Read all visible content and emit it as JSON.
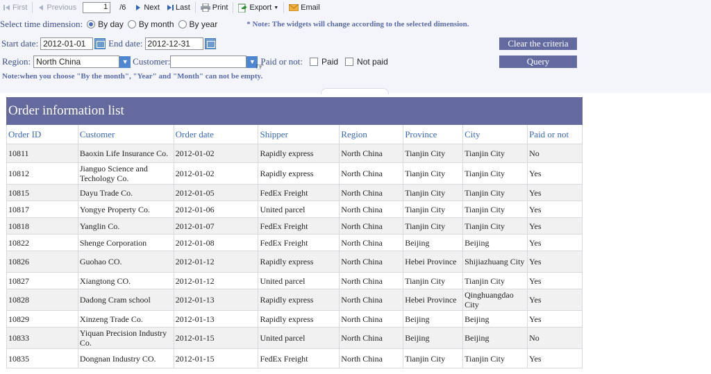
{
  "toolbar": {
    "first": "First",
    "previous": "Previous",
    "page": "1",
    "total": "/6",
    "next": "Next",
    "last": "Last",
    "print": "Print",
    "export": "Export",
    "email": "Email"
  },
  "time": {
    "label": "Select time dimension:",
    "options": [
      "By day",
      "By month",
      "By year"
    ],
    "selected": "By day",
    "note": "* Note: The widgets will change according to the selected dimension."
  },
  "dates": {
    "start_label": "Start date:",
    "start": "2012-01-01",
    "end_label": "End date:",
    "end": "2012-12-31"
  },
  "filters": {
    "region_label": "Region:",
    "region": "North China",
    "customer_label": "Customer:",
    "customer": "",
    "paid_label": "Paid or not:",
    "paid": "Paid",
    "not_paid": "Not paid"
  },
  "buttons": {
    "clear": "Clear the criteria",
    "query": "Query"
  },
  "note2": "Note:when you choose \"By the month\", \"Year\" and \"Month\" can not be empty.",
  "table": {
    "title": "Order information list",
    "columns": [
      "Order ID",
      "Customer",
      "Order date",
      "Shipper",
      "Region",
      "Province",
      "City",
      "Paid or not"
    ],
    "rows": [
      [
        "10811",
        "Baoxin Life Insurance Co.",
        "2012-01-02",
        "Rapidly express",
        "North China",
        "Tianjin City",
        "Tianjin City",
        "No"
      ],
      [
        "10812",
        "Jianguo Science and Techology Co.",
        "2012-01-02",
        "Rapidly express",
        "North China",
        "Tianjin City",
        "Tianjin City",
        "Yes"
      ],
      [
        "10815",
        "Dayu Trade Co.",
        "2012-01-05",
        "FedEx Freight",
        "North China",
        "Tianjin City",
        "Tianjin City",
        "Yes"
      ],
      [
        "10817",
        "Yongye Property Co.",
        "2012-01-06",
        "United parcel",
        "North China",
        "Tianjin City",
        "Tianjin City",
        "Yes"
      ],
      [
        "10818",
        "Yanglin Co.",
        "2012-01-07",
        "FedEx Freight",
        "North China",
        "Tianjin City",
        "Tianjin City",
        "Yes"
      ],
      [
        "10822",
        "Shenge Corporation",
        "2012-01-08",
        "FedEx Freight",
        "North China",
        "Beijing",
        "Beijing",
        "Yes"
      ],
      [
        "10826",
        "Guohao CO.",
        "2012-01-12",
        "Rapidly express",
        "North China",
        "Hebei Province",
        "Shijiazhuang City",
        "Yes"
      ],
      [
        "10827",
        "Xiangtong CO.",
        "2012-01-12",
        "United parcel",
        "North China",
        "Tianjin City",
        "Tianjin City",
        "Yes"
      ],
      [
        "10828",
        "Dadong Cram school",
        "2012-01-13",
        "Rapidly express",
        "North China",
        "Hebei Province",
        "Qinghuangdao City",
        "Yes"
      ],
      [
        "10829",
        "Xinzeng Trade Co.",
        "2012-01-13",
        "Rapidly express",
        "North China",
        "Beijing",
        "Beijing",
        "Yes"
      ],
      [
        "10833",
        "Yiquan  Precision Industry Co.",
        "2012-01-15",
        "United parcel",
        "North China",
        "Beijing",
        "Beijing",
        "No"
      ],
      [
        "10835",
        "Dongnan Industry CO.",
        "2012-01-15",
        "FedEx Freight",
        "North China",
        "Tianjin City",
        "Tianjin City",
        "Yes"
      ]
    ]
  }
}
